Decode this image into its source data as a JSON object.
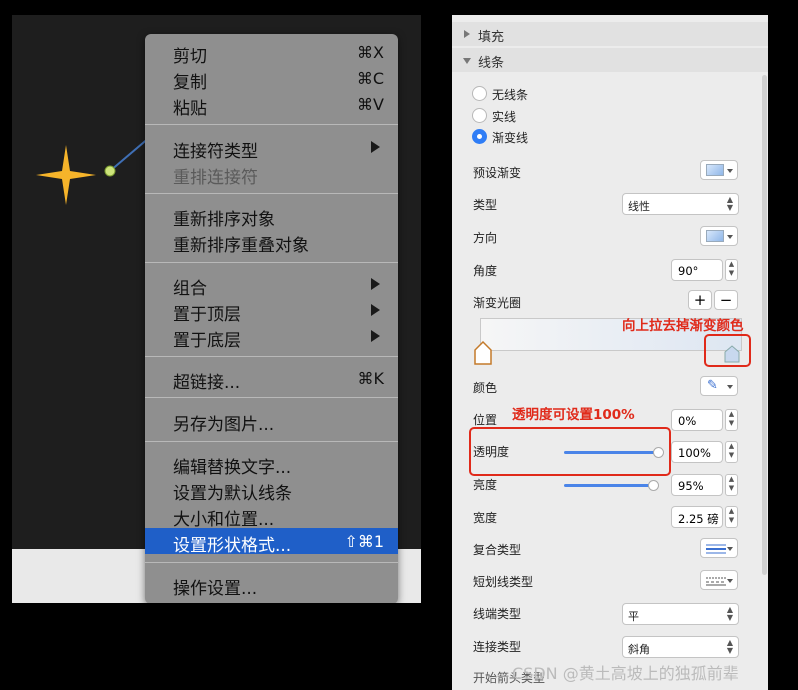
{
  "context_menu": {
    "items": [
      {
        "label": "剪切",
        "shortcut": "⌘X"
      },
      {
        "label": "复制",
        "shortcut": "⌘C"
      },
      {
        "label": "粘贴",
        "shortcut": "⌘V"
      },
      {
        "label": "连接符类型"
      },
      {
        "label": "重排连接符"
      },
      {
        "label": "重新排序对象"
      },
      {
        "label": "重新排序重叠对象"
      },
      {
        "label": "组合"
      },
      {
        "label": "置于顶层"
      },
      {
        "label": "置于底层"
      },
      {
        "label": "超链接...",
        "shortcut": "⌘K"
      },
      {
        "label": "另存为图片..."
      },
      {
        "label": "编辑替换文字..."
      },
      {
        "label": "设置为默认线条"
      },
      {
        "label": "大小和位置..."
      },
      {
        "label": "设置形状格式...",
        "shortcut": "⇧⌘1"
      },
      {
        "label": "操作设置..."
      }
    ]
  },
  "panel": {
    "fill_header": "填充",
    "line_header": "线条",
    "radio_no_line": "无线条",
    "radio_solid": "实线",
    "radio_gradient": "渐变线",
    "preset_label": "预设渐变",
    "type_label": "类型",
    "type_value": "线性",
    "direction_label": "方向",
    "angle_label": "角度",
    "angle_value": "90°",
    "stops_label": "渐变光圈",
    "add_stop": "+",
    "remove_stop": "−",
    "color_label": "颜色",
    "position_label": "位置",
    "position_value": "0%",
    "transparency_label": "透明度",
    "transparency_value": "100%",
    "transparency_level": 1.0,
    "brightness_label": "亮度",
    "brightness_value": "95%",
    "brightness_level": 0.95,
    "width_label": "宽度",
    "width_value": "2.25 磅",
    "compound_label": "复合类型",
    "dash_label": "短划线类型",
    "cap_label": "线端类型",
    "cap_value": "平",
    "join_label": "连接类型",
    "join_value": "斜角",
    "cut_off_label": "开始箭头类型"
  },
  "annotations": {
    "drag_up": "向上拉去掉渐变颜色",
    "transparency_note": "透明度可设置100%"
  },
  "colors": {
    "menu_highlight": "#1f5fc8",
    "annotation_red": "#e02a1a",
    "slider_blue": "#4a84e8",
    "star_fill": "#f6b42a"
  },
  "watermark": "CSDN @黄土高坡上的独孤前辈"
}
